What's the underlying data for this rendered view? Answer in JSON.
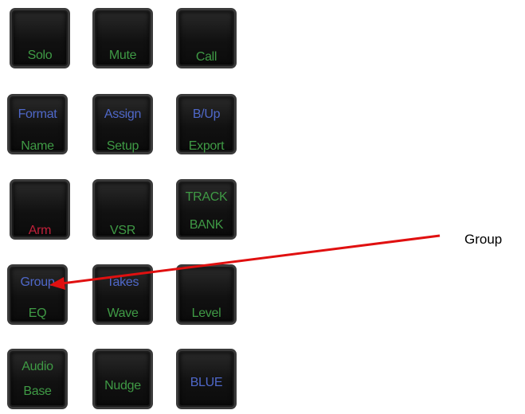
{
  "keys": {
    "solo": {
      "top": "Solo"
    },
    "mute": {
      "top": "Mute"
    },
    "call": {
      "top": "Call"
    },
    "format_name": {
      "top": "Format",
      "bottom": "Name"
    },
    "assign_setup": {
      "top": "Assign",
      "bottom": "Setup"
    },
    "bup_export": {
      "top": "B/Up",
      "bottom": "Export"
    },
    "arm": {
      "top": "Arm"
    },
    "vsr": {
      "top": "VSR"
    },
    "track_bank": {
      "top": "TRACK",
      "bottom": "BANK"
    },
    "group_eq": {
      "top": "Group",
      "bottom": "EQ"
    },
    "takes_wave": {
      "top": "Takes",
      "bottom": "Wave"
    },
    "level": {
      "top": "Level"
    },
    "audio_base": {
      "top": "Audio",
      "bottom": "Base"
    },
    "nudge": {
      "top": "Nudge"
    },
    "blue": {
      "top": "BLUE"
    }
  },
  "callout": {
    "label": "Group"
  },
  "colors": {
    "green": "#3f9a45",
    "blue": "#4f68c9",
    "red": "#c0203a",
    "arrow": "#e01010"
  }
}
